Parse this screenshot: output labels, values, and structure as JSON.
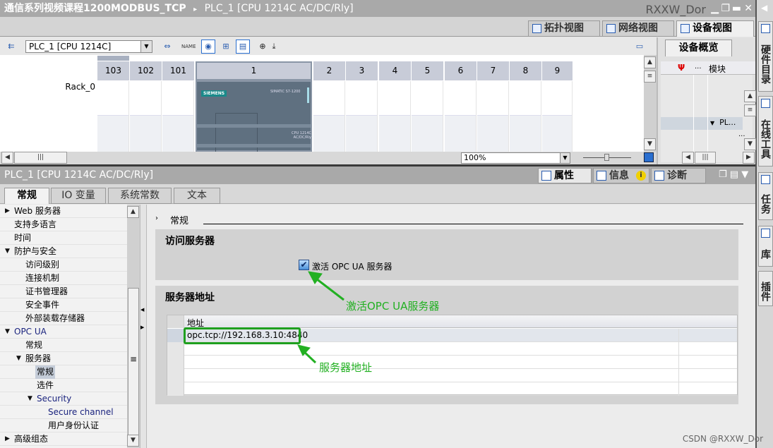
{
  "title_bar": {
    "project": "通信系列视频课程1200MODBUS_TCP",
    "separator": "▸",
    "device": "PLC_1 [CPU 1214C AC/DC/Rly]",
    "user": "RXXW_Dor"
  },
  "right_strip": {
    "tabs": [
      {
        "label": "硬件目录",
        "icon": "catalog-icon"
      },
      {
        "label": "在线工具",
        "icon": "online-tools-icon"
      },
      {
        "label": "任务",
        "icon": "tasks-icon"
      },
      {
        "label": "库",
        "icon": "library-icon"
      },
      {
        "label": "插件",
        "icon": "addin-icon"
      }
    ]
  },
  "view_tabs": [
    {
      "label": "拓扑视图",
      "icon": "topology-icon"
    },
    {
      "label": "网络视图",
      "icon": "network-icon"
    },
    {
      "label": "设备视图",
      "icon": "device-icon",
      "active": true
    }
  ],
  "toolbar": {
    "device_select": "PLC_1 [CPU 1214C]"
  },
  "rack": {
    "name": "Rack_0",
    "slots": [
      "103",
      "102",
      "101",
      "1",
      "2",
      "3",
      "4",
      "5",
      "6",
      "7",
      "8",
      "9"
    ],
    "cpu_brand": "SIEMENS",
    "cpu_line": "SIMATIC S7-1200",
    "cpu_model": "CPU 1214C AC/DC/Rly"
  },
  "zoom": {
    "value": "100%"
  },
  "device_overview": {
    "tab": "设备概览",
    "columns": [
      "...",
      "模块"
    ],
    "row_module": "PL...",
    "ellipsis": "..."
  },
  "inspector": {
    "title": "PLC_1 [CPU 1214C AC/DC/Rly]",
    "tabs": [
      {
        "label": "属性",
        "icon": "properties-icon",
        "active": true
      },
      {
        "label": "信息",
        "icon": "info-icon"
      },
      {
        "label": "诊断",
        "icon": "diagnostics-icon"
      }
    ],
    "prop_tabs": [
      {
        "label": "常规",
        "active": true
      },
      {
        "label": "IO 变量"
      },
      {
        "label": "系统常数"
      },
      {
        "label": "文本"
      }
    ]
  },
  "tree": [
    {
      "label": "Web 服务器",
      "level": 0,
      "arrow": "collapsed"
    },
    {
      "label": "支持多语言",
      "level": 1
    },
    {
      "label": "时间",
      "level": 1
    },
    {
      "label": "防护与安全",
      "level": 0,
      "arrow": "expanded"
    },
    {
      "label": "访问级别",
      "level": 2
    },
    {
      "label": "连接机制",
      "level": 2
    },
    {
      "label": "证书管理器",
      "level": 2
    },
    {
      "label": "安全事件",
      "level": 2
    },
    {
      "label": "外部装载存储器",
      "level": 2
    },
    {
      "label": "OPC UA",
      "level": 0,
      "arrow": "expanded",
      "blue": true
    },
    {
      "label": "常规",
      "level": 2
    },
    {
      "label": "服务器",
      "level": 1.5,
      "arrow": "expanded"
    },
    {
      "label": "常规",
      "level": 3,
      "selected": true
    },
    {
      "label": "选件",
      "level": 3
    },
    {
      "label": "Security",
      "level": 2.5,
      "arrow": "expanded",
      "blue": true
    },
    {
      "label": "Secure channel",
      "level": 4,
      "blue": true
    },
    {
      "label": "用户身份认证",
      "level": 4
    },
    {
      "label": "高级组态",
      "level": 0,
      "arrow": "collapsed"
    }
  ],
  "content": {
    "breadcrumb": "常规",
    "access_section": {
      "title": "访问服务器",
      "checkbox_label": "激活 OPC UA 服务器",
      "checked": true
    },
    "address_section": {
      "title": "服务器地址",
      "column": "地址",
      "rows": [
        "opc.tcp://192.168.3.10:4840",
        "",
        "",
        "",
        ""
      ]
    }
  },
  "annotations": {
    "checkbox_note": "激活OPC UA服务器",
    "address_note": "服务器地址",
    "color": "#22b022"
  },
  "watermark": "CSDN @RXXW_Dor"
}
